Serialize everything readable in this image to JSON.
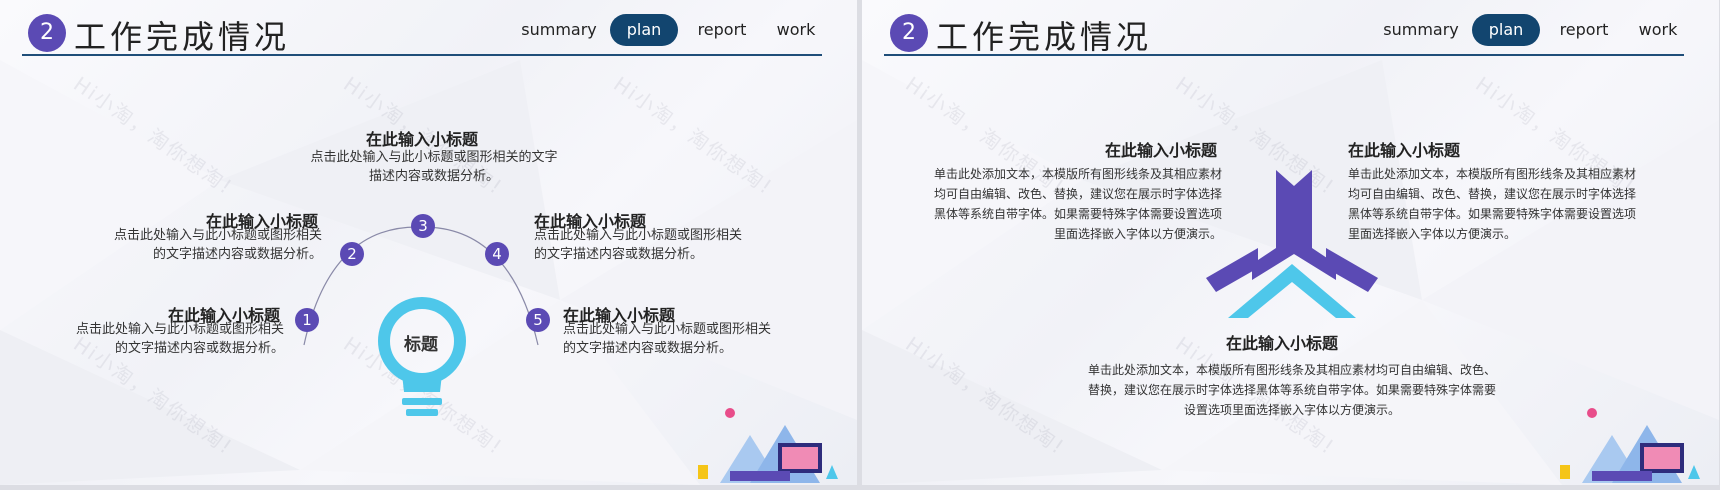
{
  "slides": [
    {
      "badge": "2",
      "title": "工作完成情况",
      "nav": [
        "summary",
        "plan",
        "report",
        "work"
      ],
      "watermark": "Hi小淘，淘你想淘!",
      "items": [
        {
          "num": "3",
          "title": "在此输入小标题",
          "lines": [
            "点击此处输入与此小标题或图形相关的文字",
            "描述内容或数据分析。"
          ]
        },
        {
          "num": "2",
          "title": "在此输入小标题",
          "lines": [
            "点击此处输入与此小标题或图形相关",
            "的文字描述内容或数据分析。"
          ]
        },
        {
          "num": "4",
          "title": "在此输入小标题",
          "lines": [
            "点击此处输入与此小标题或图形相关",
            "的文字描述内容或数据分析。"
          ]
        },
        {
          "num": "1",
          "title": "在此输入小标题",
          "lines": [
            "点击此处输入与此小标题或图形相关",
            "的文字描述内容或数据分析。"
          ]
        },
        {
          "num": "5",
          "title": "在此输入小标题",
          "lines": [
            "点击此处输入与此小标题或图形相关",
            "的文字描述内容或数据分析。"
          ]
        }
      ],
      "bulb_label": "标题"
    },
    {
      "badge": "2",
      "title": "工作完成情况",
      "nav": [
        "summary",
        "plan",
        "report",
        "work"
      ],
      "watermark": "Hi小淘，淘你想淘!",
      "items": [
        {
          "title": "在此输入小标题",
          "lines": [
            "单击此处添加文本，本模版所有图形线条及其相应素材",
            "均可自由编辑、改色、替换，建议您在展示时字体选择",
            "黑体等系统自带字体。如果需要特殊字体需要设置选项",
            "里面选择嵌入字体以方便演示。"
          ]
        },
        {
          "title": "在此输入小标题",
          "lines": [
            "单击此处添加文本，本模版所有图形线条及其相应素材",
            "均可自由编辑、改色、替换，建议您在展示时字体选择",
            "黑体等系统自带字体。如果需要特殊字体需要设置选项",
            "里面选择嵌入字体以方便演示。"
          ]
        },
        {
          "title": "在此输入小标题",
          "lines": [
            "单击此处添加文本，本模版所有图形线条及其相应素材均可自由编辑、改色、",
            "替换，建议您在展示时字体选择黑体等系统自带字体。如果需要特殊字体需要",
            "设置选项里面选择嵌入字体以方便演示。"
          ]
        }
      ]
    }
  ],
  "colors": {
    "accent": "#5b4ab4",
    "navy": "#12456f",
    "cyan": "#4ec7ea"
  }
}
